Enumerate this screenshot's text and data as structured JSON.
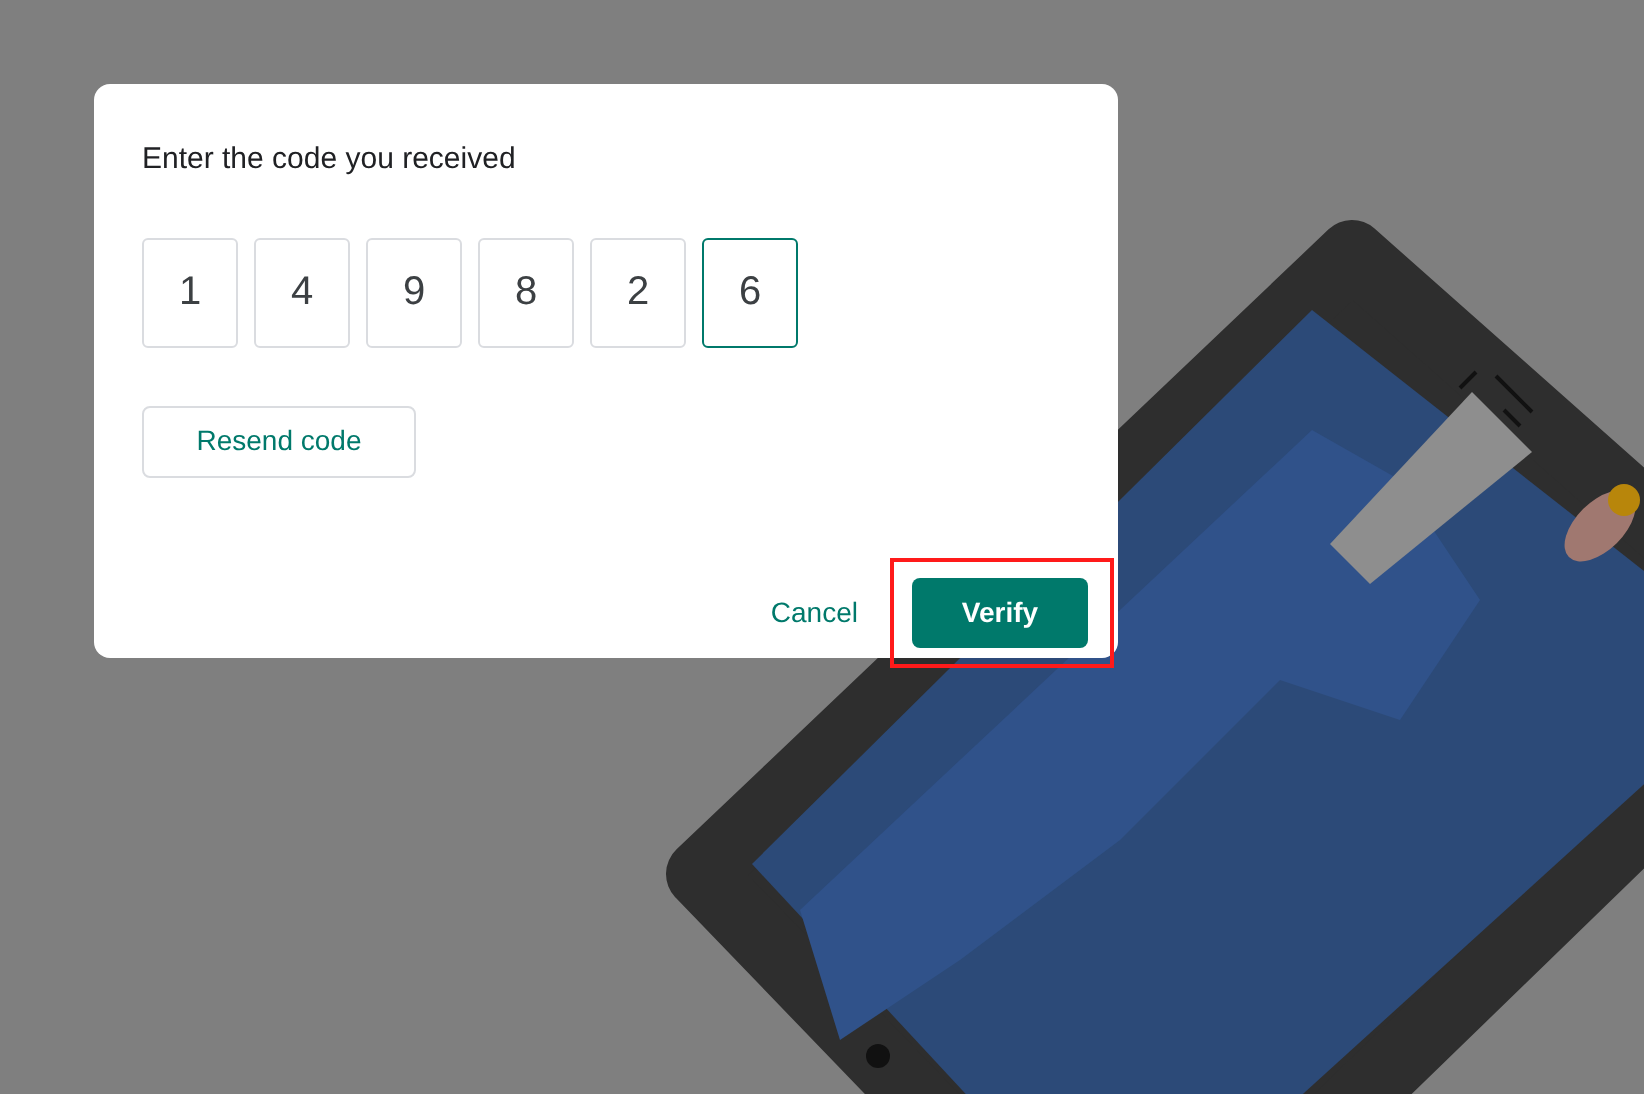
{
  "dialog": {
    "title": "Enter the code you received",
    "code_digits": [
      {
        "value": "1",
        "selected": false
      },
      {
        "value": "4",
        "selected": false
      },
      {
        "value": "9",
        "selected": false
      },
      {
        "value": "8",
        "selected": false
      },
      {
        "value": "2",
        "selected": false
      },
      {
        "value": "6",
        "selected": true
      }
    ],
    "resend_button": "Resend code",
    "actions": [
      {
        "label": "Cancel",
        "kind": "text",
        "highlighted": false
      },
      {
        "label": "Verify",
        "kind": "filled",
        "highlighted": true
      }
    ]
  }
}
